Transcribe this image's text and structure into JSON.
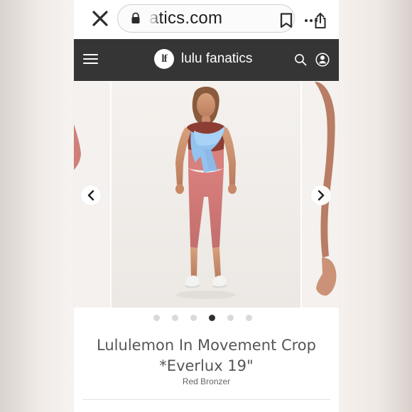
{
  "browser": {
    "address_text": "atics.com",
    "icons": {
      "close": "close-icon",
      "lock": "lock-icon",
      "bookmark": "bookmark-icon",
      "share": "share-icon",
      "more": "more-icon"
    }
  },
  "header": {
    "logo_text": "lf",
    "brand_name": "lulu fanatics",
    "icons": {
      "menu": "menu-icon",
      "search": "search-icon",
      "account": "account-icon"
    },
    "colors": {
      "background": "#353535",
      "foreground": "#ffffff"
    }
  },
  "carousel": {
    "current_slide": 4,
    "slide_count": 6,
    "icons": {
      "previous": "chevron-left-icon",
      "next": "chevron-right-icon"
    }
  },
  "product": {
    "title_line1": "Lululemon In Movement Crop",
    "title_line2": "*Everlux 19\"",
    "color_name": "Red Bronzer"
  }
}
